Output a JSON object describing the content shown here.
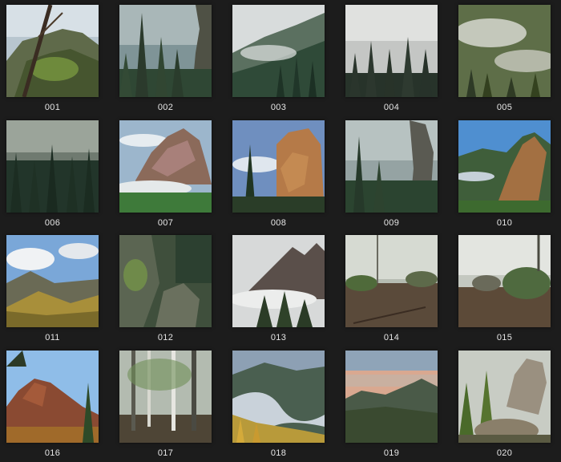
{
  "gallery": {
    "items": [
      {
        "label": "001",
        "scene": "rocky-cliff-with-pine"
      },
      {
        "label": "002",
        "scene": "foggy-forest-cliff"
      },
      {
        "label": "003",
        "scene": "misty-hillside-forest"
      },
      {
        "label": "004",
        "scene": "fog-over-conifers"
      },
      {
        "label": "005",
        "scene": "aerial-misty-forest"
      },
      {
        "label": "006",
        "scene": "dark-foggy-forest"
      },
      {
        "label": "007",
        "scene": "rock-outcrop-with-clouds"
      },
      {
        "label": "008",
        "scene": "rock-face-profile"
      },
      {
        "label": "009",
        "scene": "forest-with-rock-pillar"
      },
      {
        "label": "010",
        "scene": "mountain-crag-blue-sky"
      },
      {
        "label": "011",
        "scene": "autumn-hillside-clouds"
      },
      {
        "label": "012",
        "scene": "mossy-boulders-in-forest"
      },
      {
        "label": "013",
        "scene": "peak-above-fog"
      },
      {
        "label": "014",
        "scene": "misty-forest-floor"
      },
      {
        "label": "015",
        "scene": "sunlit-misty-woods"
      },
      {
        "label": "016",
        "scene": "red-rock-ridge"
      },
      {
        "label": "017",
        "scene": "birch-trees-in-fog"
      },
      {
        "label": "018",
        "scene": "autumn-river-valley"
      },
      {
        "label": "019",
        "scene": "sunset-over-taiga"
      },
      {
        "label": "020",
        "scene": "larch-and-rock-formation"
      }
    ]
  }
}
